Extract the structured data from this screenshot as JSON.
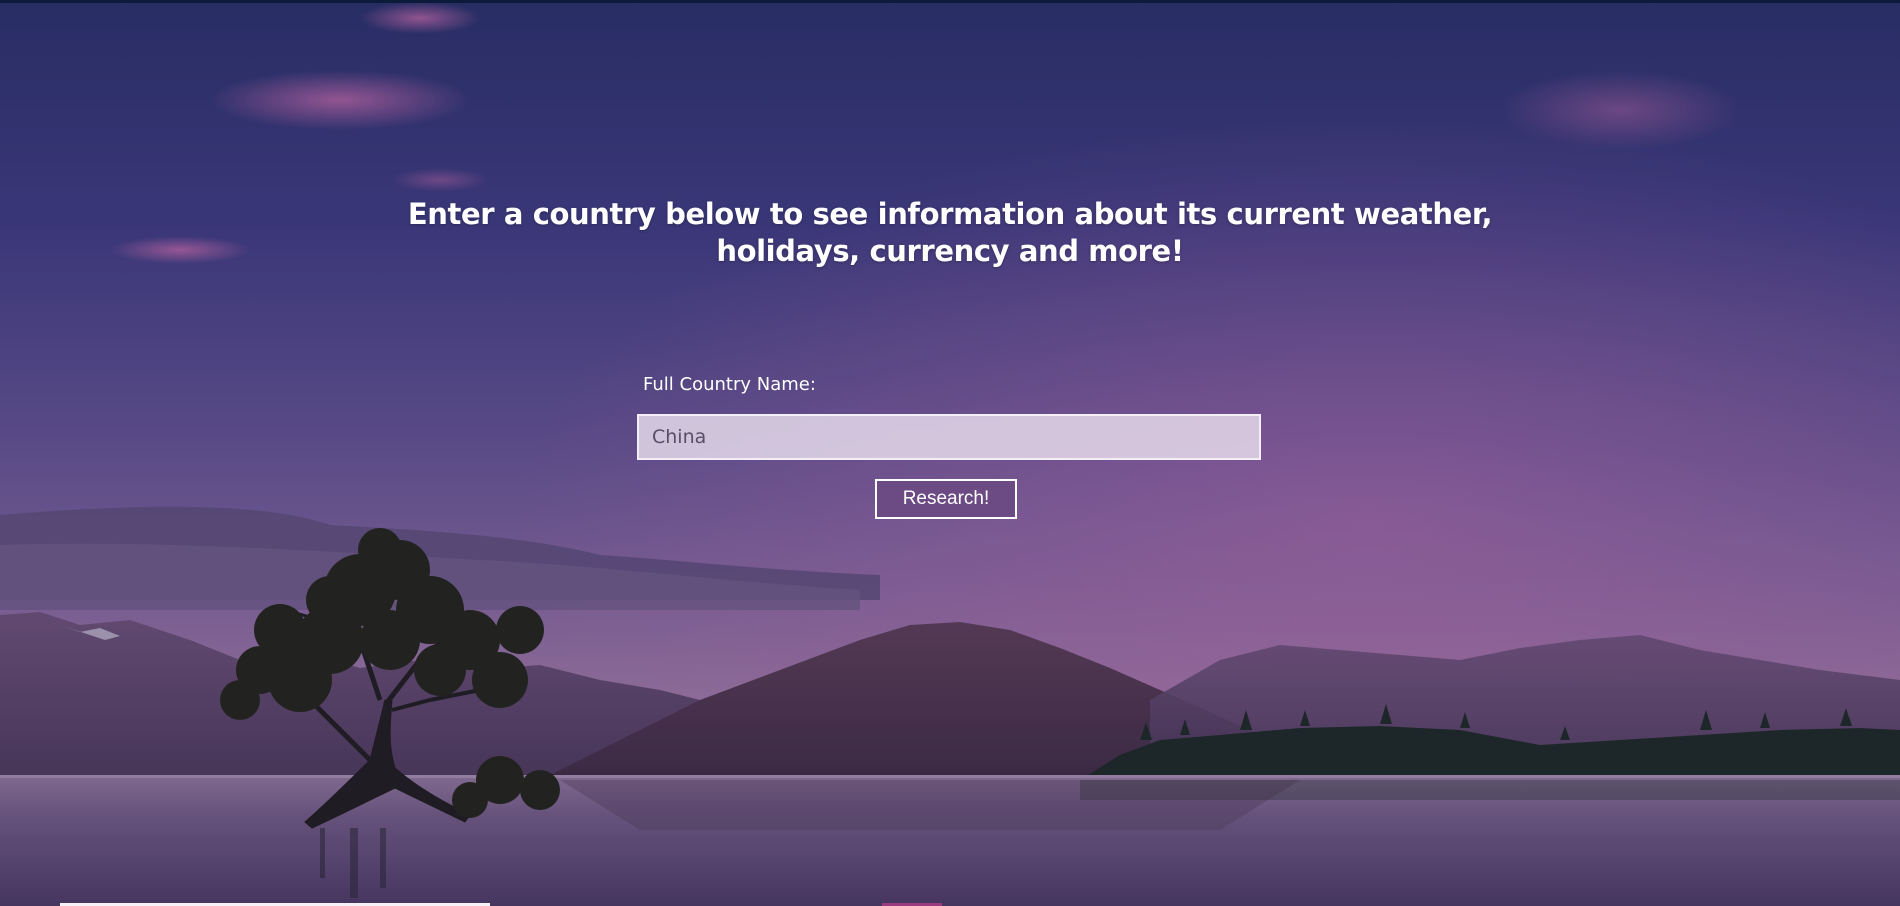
{
  "hero": {
    "heading": "Enter a country below to see information about its current weather, holidays, currency and more!"
  },
  "search_form": {
    "label": "Full Country Name:",
    "input_value": "China",
    "submit_label": "Research!"
  },
  "background": {
    "description_icon": "landscape-background",
    "sky_top_color": "#2c3468",
    "sky_mid_color": "#6a5496",
    "horizon_color": "#9a6a9a",
    "water_color": "#5f4a74",
    "mountain_color": "#4a3553",
    "tree_color": "#1f1d1e"
  }
}
